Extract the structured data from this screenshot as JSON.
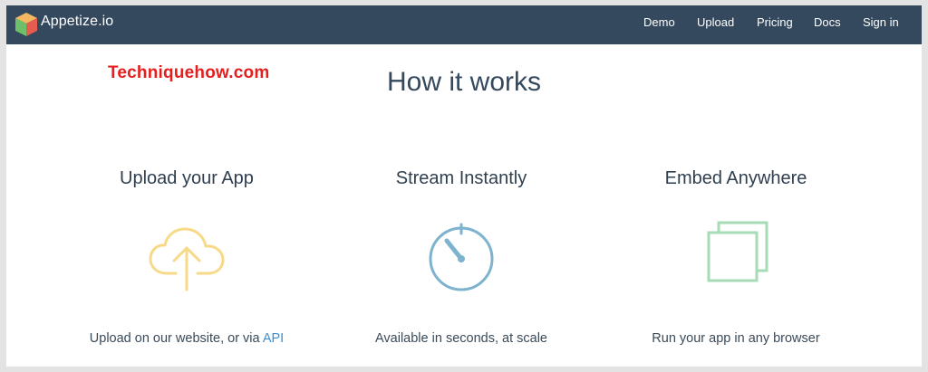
{
  "brand": {
    "name": "Appetize.io",
    "logo_colors": {
      "top": "#f4b960",
      "left": "#6dbf6a",
      "right": "#e65c4f"
    }
  },
  "nav": {
    "links": [
      "Demo",
      "Upload",
      "Pricing",
      "Docs",
      "Sign in"
    ]
  },
  "watermark": "Techniquehow.com",
  "page_title": "How it works",
  "features": [
    {
      "heading": "Upload your App",
      "icon": "cloud-upload-icon",
      "icon_color": "#f7d987",
      "desc_prefix": "Upload on our website, or via ",
      "desc_link": "API"
    },
    {
      "heading": "Stream Instantly",
      "icon": "stopwatch-icon",
      "icon_color": "#7db3cf",
      "desc": "Available in seconds, at scale"
    },
    {
      "heading": "Embed Anywhere",
      "icon": "overlapping-squares-icon",
      "icon_color": "#a6dcb6",
      "desc": "Run your app in any browser"
    }
  ],
  "colors": {
    "navbar": "#34495e",
    "link": "#3a8fd1",
    "watermark": "#e51e1e"
  }
}
